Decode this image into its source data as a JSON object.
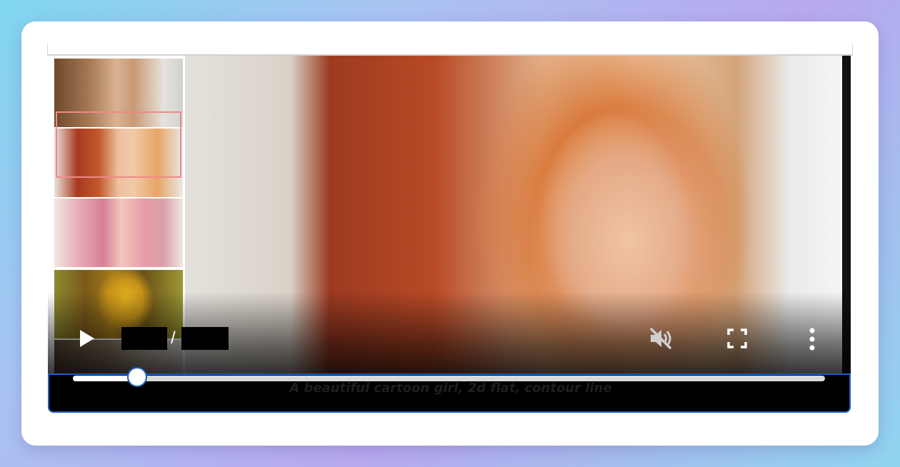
{
  "player": {
    "time_current": "",
    "time_separator": "/",
    "time_total": "",
    "caption": "A beautiful cartoon girl, 2d flat, contour line",
    "seek_progress": 0.085,
    "muted": true
  },
  "thumbnails": [
    {
      "name": "portrait-brunette"
    },
    {
      "name": "portrait-redhead-cartoon",
      "selected": true
    },
    {
      "name": "portrait-pink-hair"
    },
    {
      "name": "portrait-mona-lisa"
    },
    {
      "name": "portrait-grey"
    }
  ],
  "icons": {
    "play": "play-icon",
    "mute": "volume-muted-icon",
    "fullscreen": "fullscreen-icon",
    "menu": "more-vertical-icon"
  },
  "colors": {
    "accent": "#1f5fc4",
    "selection": "#ef8a8a"
  }
}
